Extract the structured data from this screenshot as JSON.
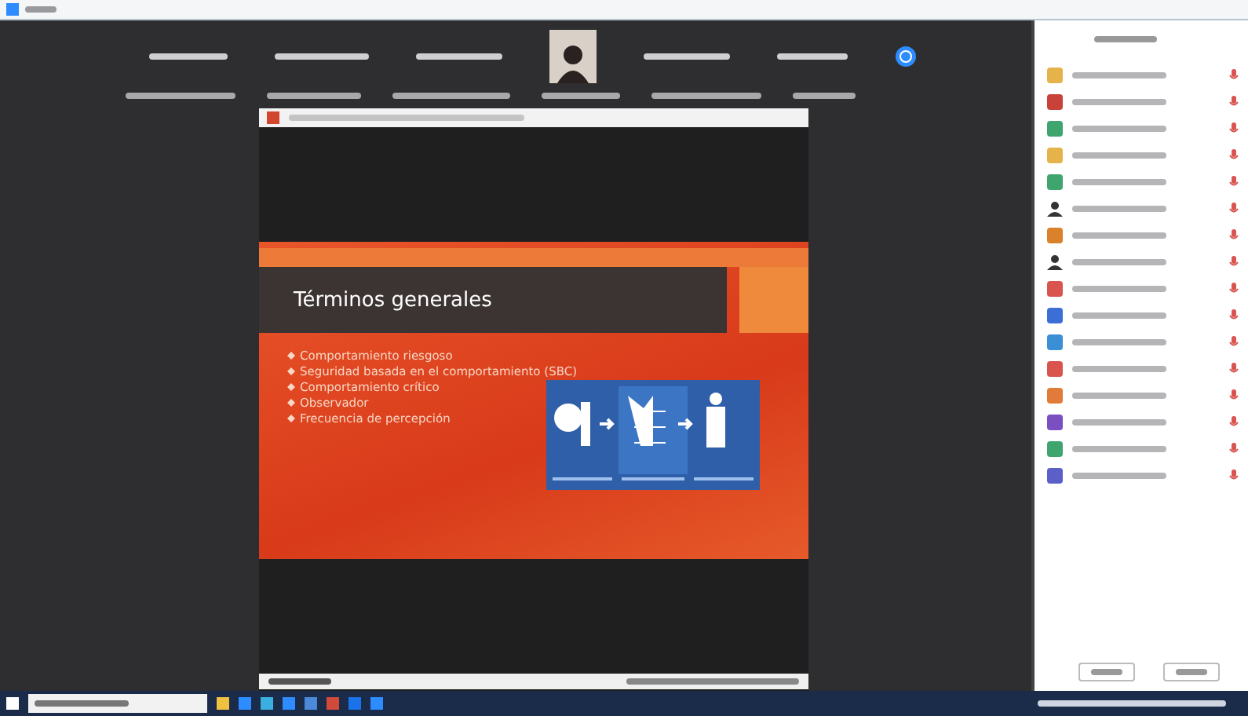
{
  "slide": {
    "title": "Términos generales",
    "bullets": [
      "Comportamiento riesgoso",
      "Seguridad basada en el comportamiento (SBC)",
      "Comportamiento crítico",
      "Observador",
      "Frecuencia de percepción"
    ]
  },
  "participants": [
    {
      "kind": "initial",
      "color": "#e6b34a"
    },
    {
      "kind": "initial",
      "color": "#c8423a"
    },
    {
      "kind": "initial",
      "color": "#3fa56e"
    },
    {
      "kind": "initial",
      "color": "#e6b34a"
    },
    {
      "kind": "initial",
      "color": "#3fa56e"
    },
    {
      "kind": "photo"
    },
    {
      "kind": "initial",
      "color": "#d9822b"
    },
    {
      "kind": "photo"
    },
    {
      "kind": "initial",
      "color": "#d9534f"
    },
    {
      "kind": "initial",
      "color": "#3b6fd6"
    },
    {
      "kind": "initial",
      "color": "#3b8fd6"
    },
    {
      "kind": "initial",
      "color": "#d9534f"
    },
    {
      "kind": "initial",
      "color": "#e07b39"
    },
    {
      "kind": "initial",
      "color": "#7a4fc2"
    },
    {
      "kind": "initial",
      "color": "#3fa56e"
    },
    {
      "kind": "initial",
      "color": "#5b5fc7"
    }
  ]
}
